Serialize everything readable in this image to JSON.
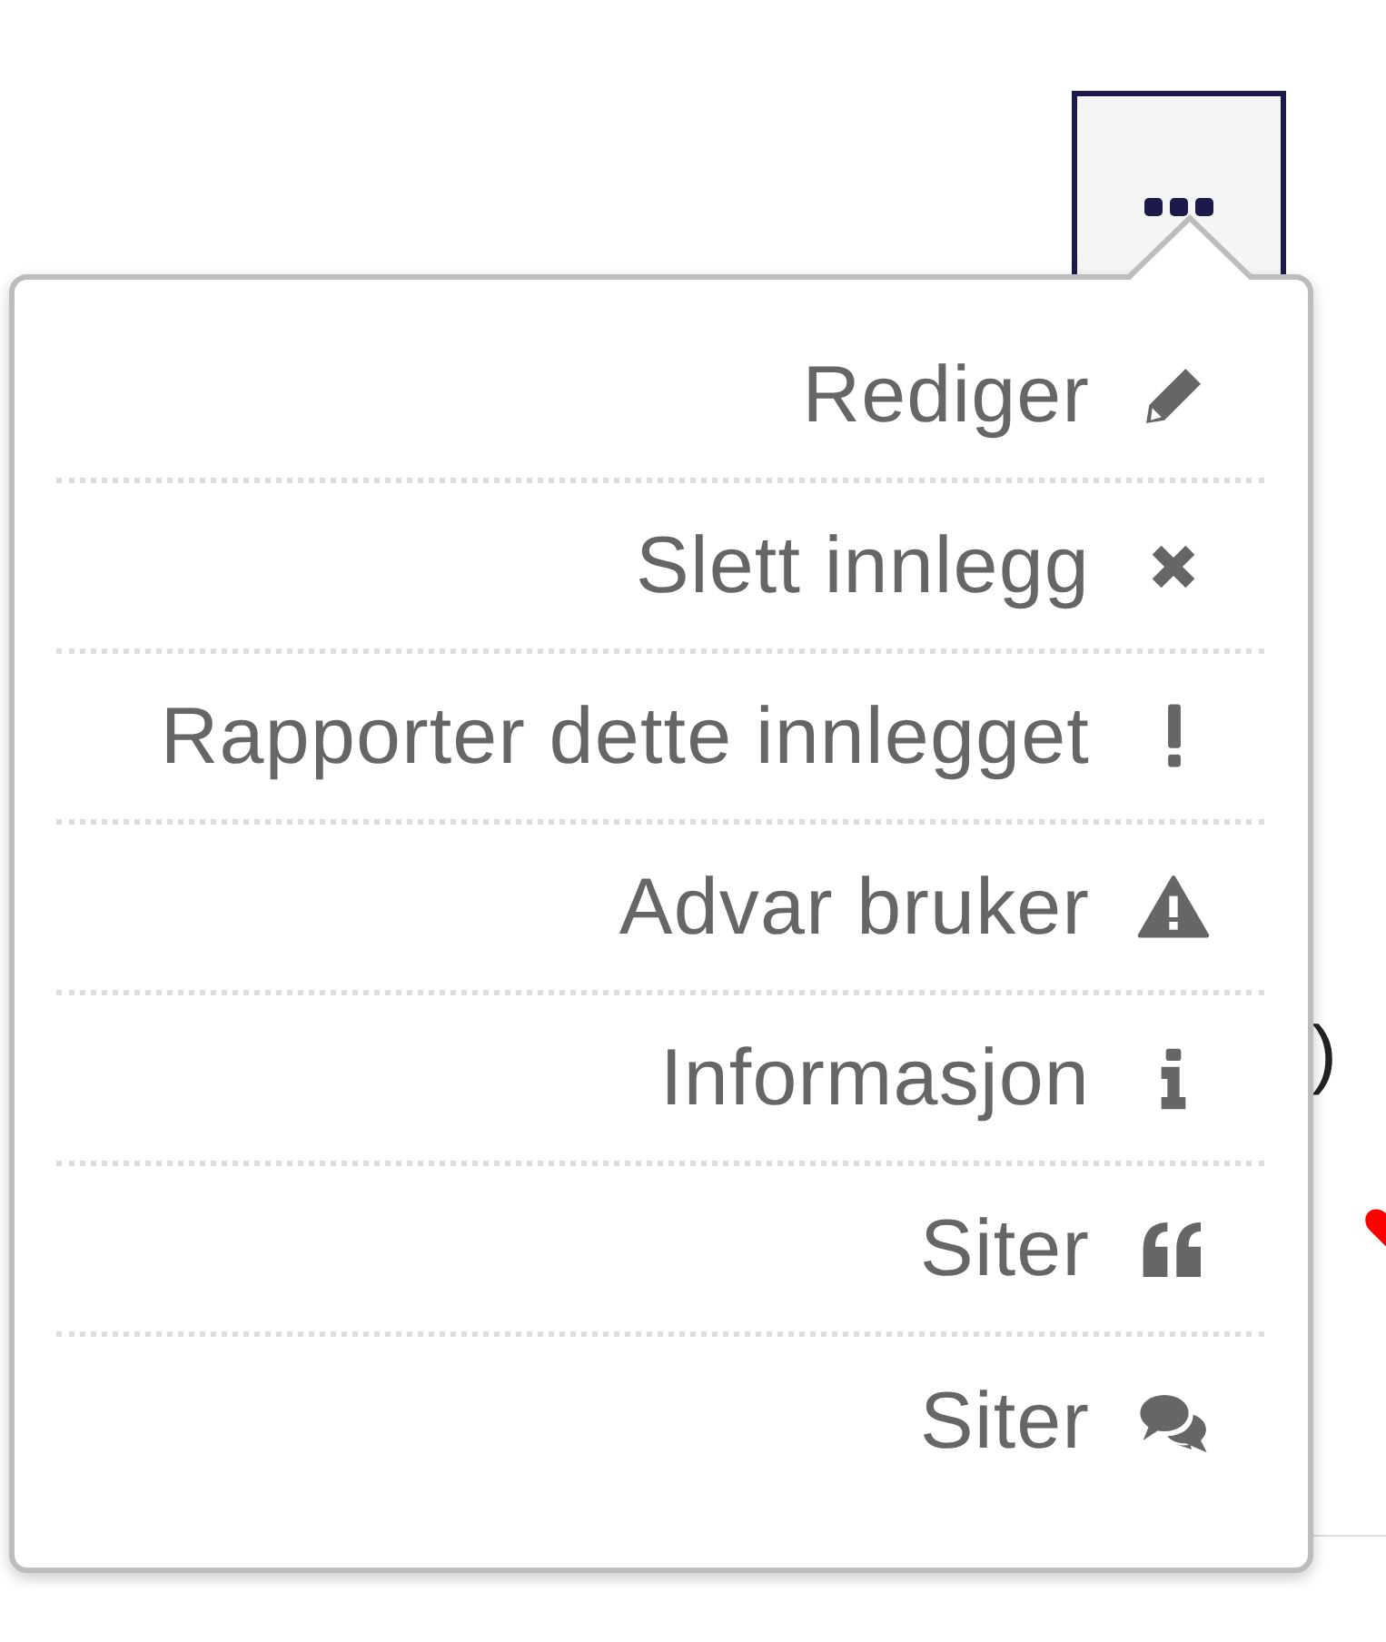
{
  "background": {
    "paren": ")"
  },
  "menu": {
    "items": [
      {
        "label": "Rediger",
        "kind": "edit"
      },
      {
        "label": "Slett innlegg",
        "kind": "delete"
      },
      {
        "label": "Rapporter dette innlegget",
        "kind": "report"
      },
      {
        "label": "Advar bruker",
        "kind": "warn"
      },
      {
        "label": "Informasjon",
        "kind": "info"
      },
      {
        "label": "Siter",
        "kind": "quote"
      },
      {
        "label": "Siter",
        "kind": "reply"
      }
    ]
  }
}
